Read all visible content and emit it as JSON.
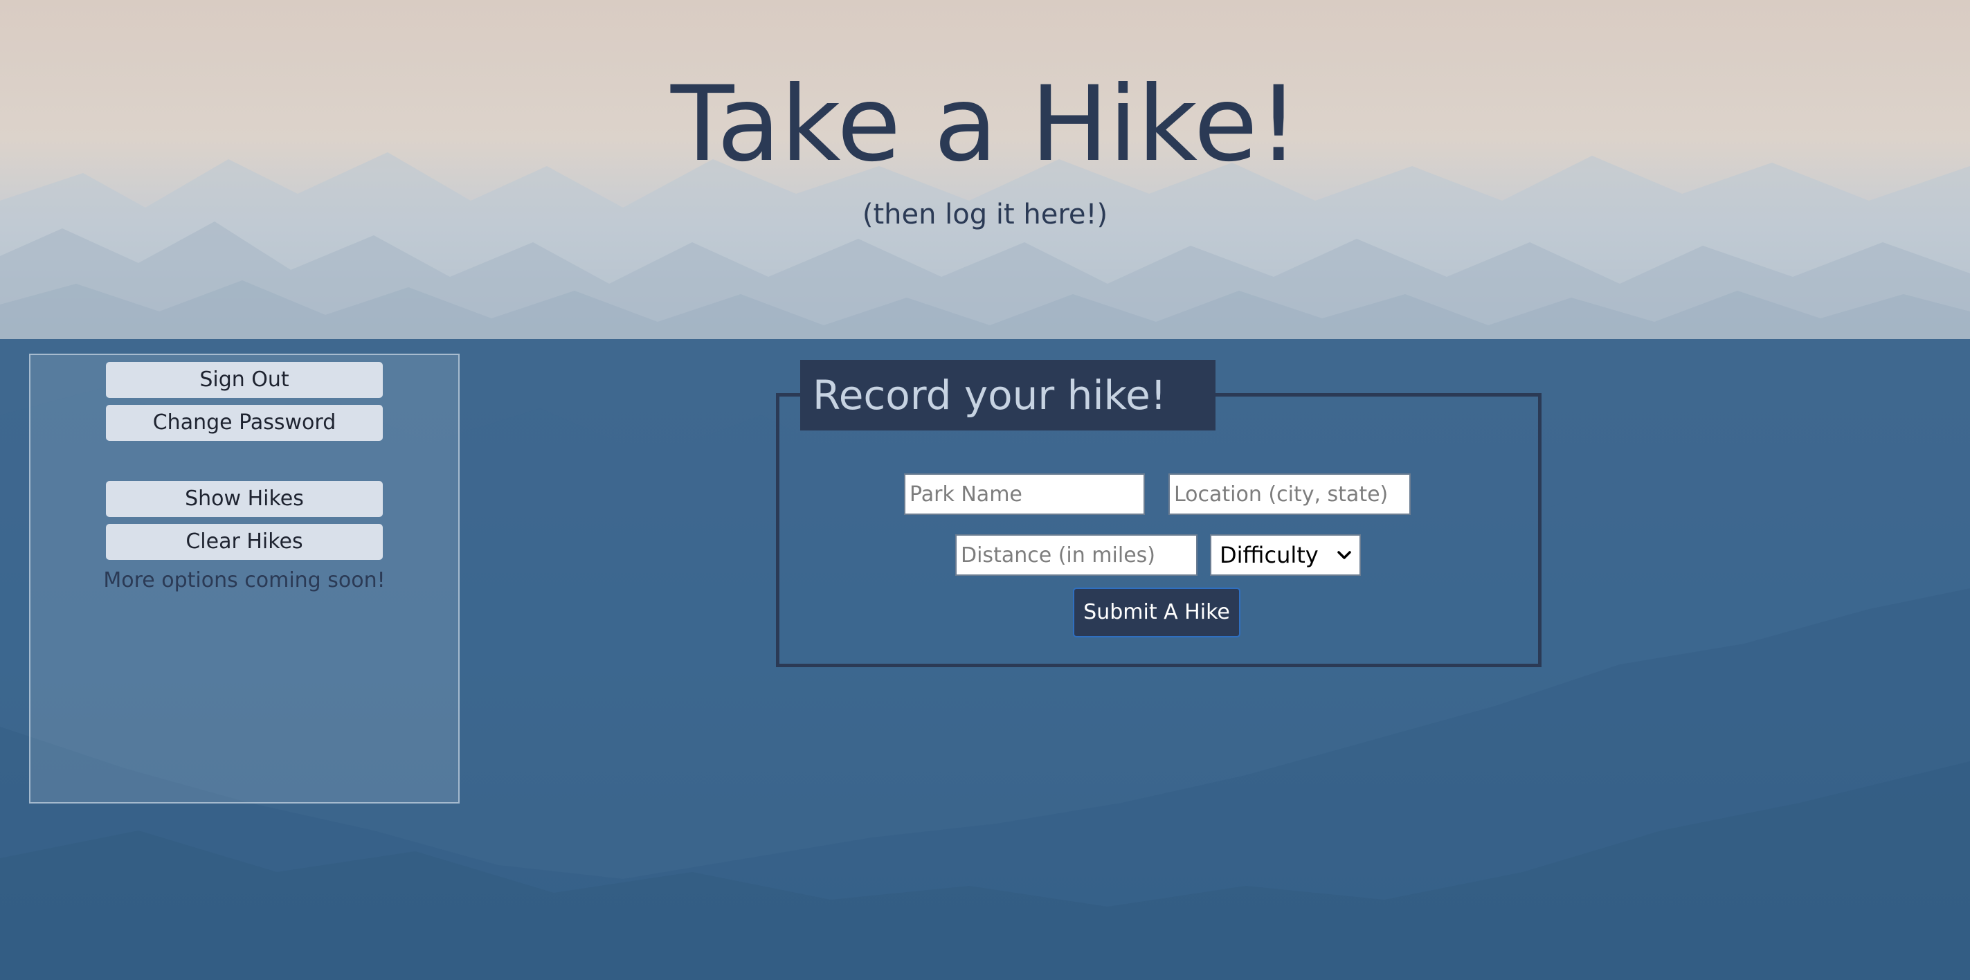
{
  "header": {
    "title": "Take a Hike!",
    "subtitle": "(then log it here!)"
  },
  "sidebar": {
    "buttons": {
      "sign_out": "Sign Out",
      "change_password": "Change Password",
      "show_hikes": "Show Hikes",
      "clear_hikes": "Clear Hikes"
    },
    "note": "More options coming soon!"
  },
  "form": {
    "legend": "Record your hike!",
    "park_name": {
      "value": "",
      "placeholder": "Park Name"
    },
    "location": {
      "value": "",
      "placeholder": "Location (city, state)"
    },
    "distance": {
      "value": "",
      "placeholder": "Distance (in miles)"
    },
    "difficulty": {
      "selected": "Difficulty"
    },
    "submit_label": "Submit A Hike"
  },
  "colors": {
    "navy": "#2b3a55",
    "sidebar_button": "#d9e0ea",
    "submit_border": "#2f6fc0",
    "legend_text": "#c7d3e2"
  },
  "icons": {
    "select_arrow": "chevron-down-icon"
  }
}
